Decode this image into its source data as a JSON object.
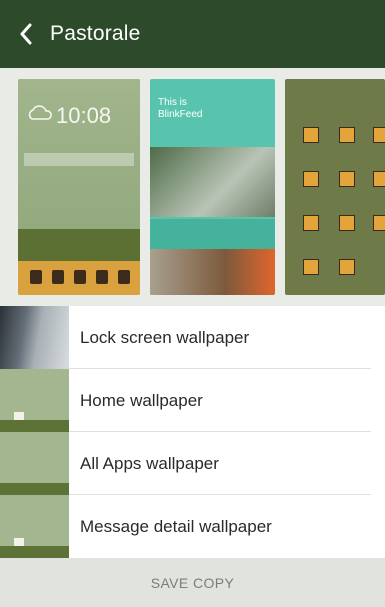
{
  "app_bar": {
    "title": "Pastorale",
    "back_icon": "chevron-left-icon"
  },
  "previews": {
    "lock": {
      "time": "10:08"
    },
    "blinkfeed": {
      "line1": "This is",
      "line2": "BlinkFeed"
    }
  },
  "list": {
    "items": [
      {
        "label": "Lock screen wallpaper"
      },
      {
        "label": "Home wallpaper"
      },
      {
        "label": "All Apps wallpaper"
      },
      {
        "label": "Message detail wallpaper"
      }
    ]
  },
  "actions": {
    "save_copy": "SAVE COPY"
  },
  "colors": {
    "app_bar": "#2d4a2b",
    "accent_teal": "#59c4ae",
    "field_green": "#98ad83"
  }
}
